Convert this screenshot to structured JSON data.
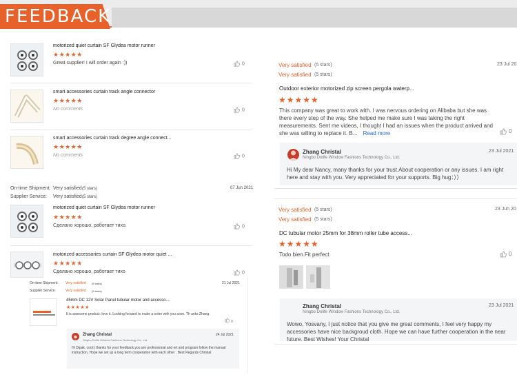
{
  "banner": {
    "title": "FEEDBACK"
  },
  "colors": {
    "accent": "#e8612a",
    "star": "#e8612a",
    "link": "#1a66d9"
  },
  "left": {
    "items": [
      {
        "title": "motorized quiet curtain SF Glydea motor runner",
        "stars": "★★★★★",
        "text": "Great supplier! I will order again :))",
        "likes": "0"
      },
      {
        "title": "smart accessories curtain track angle connector",
        "stars": "★★★★★",
        "text": "No comments",
        "likes": "0"
      },
      {
        "title": "smart accessories curtain track degree angle connect...",
        "stars": "★★★★★",
        "text": "No comments",
        "likes": "0"
      }
    ],
    "ratings": {
      "shipment_label": "On-time Shipment:",
      "shipment_value": "Very satisfied",
      "shipment_stars": "(5 stars)",
      "service_label": "Supplier Service:",
      "service_value": "Very satisfied",
      "service_stars": "(5 stars)",
      "date": "07 Jun 2021"
    },
    "items2": [
      {
        "title": "motorized quiet curtain SF Glydea motor runner",
        "stars": "★★★★★",
        "text": "Сделано хорошо, работает тихо.",
        "likes": "0"
      },
      {
        "title": "motorized accessories curtain SF Glydea motor quiet ...",
        "stars": "★★★★★",
        "text": "Сделано хорошо, работает тихо",
        "likes": "0"
      }
    ],
    "nested": {
      "shipment_label": "On-time Shipment:",
      "shipment_value": "Very satisfied",
      "shipment_stars": "(5 stars)",
      "service_label": "Supplier Service:",
      "service_value": "Very satisfied",
      "service_stars": "(5 stars)",
      "date": "21 Jul 2021",
      "title": "45mm DC 12V Solar Panel tubular motor and accesso...",
      "stars": "★★★★★",
      "text": "It is awesome product. love it. Looking forward to make a order with you soon. Th anks Zhang.",
      "likes": "0",
      "reply": {
        "name": "Zhang Christal",
        "company": "Ningbo Dolife Window Fashions Technology Co., Ltd.",
        "date": "24 Jul 2021",
        "text": "Hi Dipak, cool:) thanks for your feedback.you are professional and ert and program follow the manual instruction. Hope we set up a long term cooperation with each other . Best Regards Christal"
      }
    }
  },
  "right": {
    "r1": {
      "shipment": "Very satisfied",
      "shipment_stars": "(5 stars)",
      "service": "Very satisfied",
      "service_stars": "(5 stars)",
      "date": "23 Jul 20",
      "title": "Outdoor exterior motorized zip screen pergola waterp...",
      "stars": "★★★★★",
      "body": "This company was great to work with.  I was nervous ordering on Alibaba but she was there every step of the way.  She helped me make sure I was taking the right measurements. Sent me videos,  I thought I had an issues when the product arrived and she was willing to replace it.  B...",
      "more": "Read more",
      "likes": "0",
      "reply": {
        "name": "Zhang Christal",
        "company": "Ningbo Dolife Window Fashions Technology Co., Ltd.",
        "date": "23 Jul 2021",
        "text": "Hi My dear Nancy, many thanks for your trust.About cooperation or any issues. I am right here and stay with you. Very appreciated for your supports. Big hug：））"
      }
    },
    "r2": {
      "shipment": "Very satisfied",
      "shipment_stars": "(5 stars)",
      "service": "Very satisfied",
      "service_stars": "(5 stars)",
      "date": "23 Jun 20",
      "title": "DC tubular motor 25mm for 38mm roller tube access...",
      "stars": "★★★★★",
      "body": "Todo bien.Fit perfect",
      "likes": "0",
      "reply": {
        "name": "Zhang Christal",
        "company": "Ningbo Dolife Window Fashions Technology Co., Ltd.",
        "date": "23 Jul 2021",
        "text": "Wowo, Yosvany, I just notice that you give me great comments, I feel very happy my accessories have nice backgroud cloth. Hope we can have further cooperation in the near future. Best Wishes! Your Christal"
      }
    }
  }
}
